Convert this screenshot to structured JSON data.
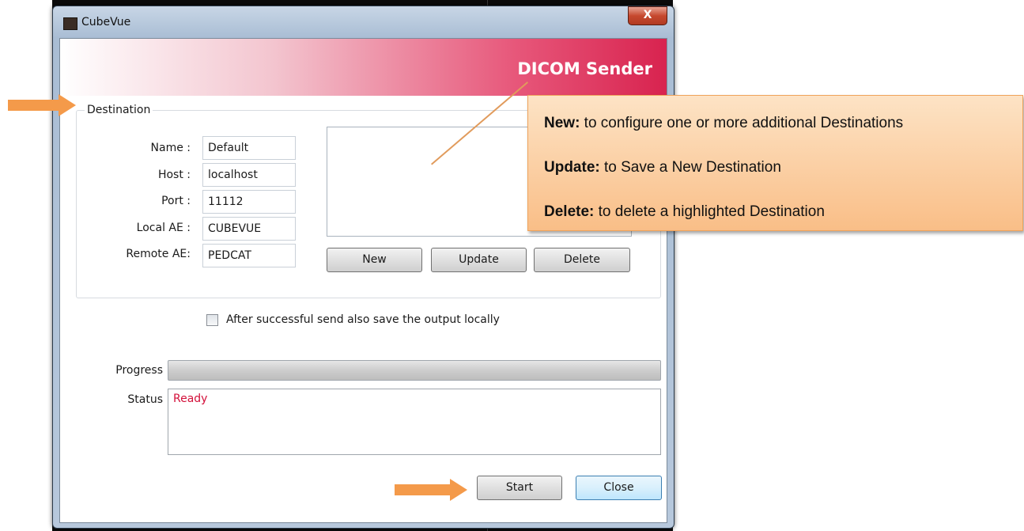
{
  "window": {
    "title": "CubeVue",
    "close_glyph": "X"
  },
  "header": {
    "title": "DICOM Sender"
  },
  "destination": {
    "group_label": "Destination",
    "fields": [
      {
        "label": "Name :",
        "value": "Default"
      },
      {
        "label": "Host :",
        "value": "localhost"
      },
      {
        "label": "Port :",
        "value": "11112"
      },
      {
        "label": "Local AE :",
        "value": "CUBEVUE"
      },
      {
        "label": "Remote AE:",
        "value": "PEDCAT"
      }
    ],
    "buttons": {
      "new": "New",
      "update": "Update",
      "delete": "Delete"
    }
  },
  "options": {
    "save_locally_label": "After successful send also save the output locally",
    "save_locally_checked": false
  },
  "progress": {
    "label": "Progress",
    "value": 0
  },
  "status": {
    "label": "Status",
    "text": "Ready"
  },
  "footer": {
    "start": "Start",
    "close": "Close"
  },
  "callout": {
    "lines": [
      {
        "term": "New:",
        "text": " to configure one or more additional Destinations"
      },
      {
        "term": "Update:",
        "text": "  to Save a New Destination"
      },
      {
        "term": "Delete:",
        "text": "  to delete a highlighted Destination"
      }
    ]
  },
  "colors": {
    "arrow": "#f49a4a",
    "status_text": "#d3103a",
    "header_accent": "#d8234f",
    "callout_bg": "#fbcf9f"
  },
  "icons": {
    "app": "cube-app-icon",
    "close": "close-icon",
    "arrow": "orange-arrow-icon"
  }
}
